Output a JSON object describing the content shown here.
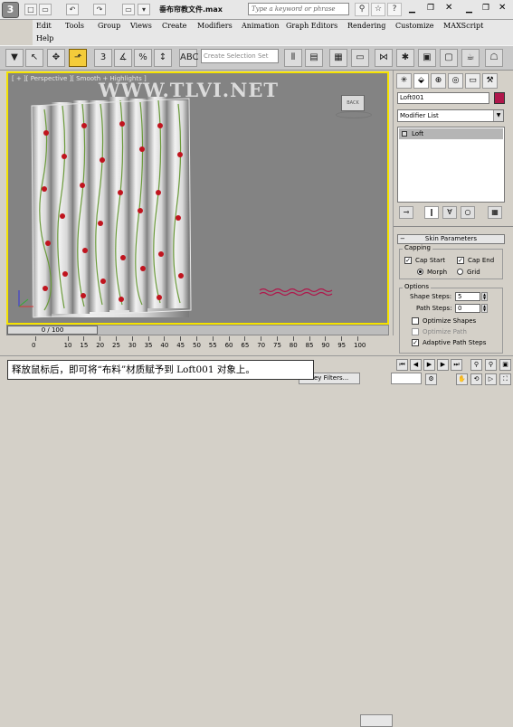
{
  "titlebar": {
    "logo_glyph": "3",
    "doc_title": "垂布帘教文件.max",
    "search_placeholder": "Type a keyword or phrase",
    "quick_access": [
      "□",
      "▭",
      "↶",
      "↷",
      "▭",
      "▾"
    ],
    "tools": [
      "⚲",
      "☆",
      "?"
    ]
  },
  "menu": {
    "row1": [
      "Edit",
      "Tools",
      "Group",
      "Views",
      "Create",
      "Modifiers",
      "Animation",
      "Graph Editors",
      "Rendering",
      "Customize",
      "MAXScript"
    ],
    "row2": [
      "Help"
    ]
  },
  "toolbar": {
    "selection_set_placeholder": "Create Selection Set",
    "buttons": [
      "▼",
      "↖",
      "✥",
      "⬏",
      "3",
      "%",
      "↕",
      "ABC"
    ]
  },
  "viewport": {
    "label": "[ + ][ Perspective ][ Smooth + Highlights ]",
    "watermark": "WWW.TLVI.NET",
    "viewcube_face": "BACK"
  },
  "command_panel": {
    "tabs": [
      "✳",
      "⬙",
      "⊕",
      "◎",
      "▭",
      "⚒"
    ],
    "object_name": "Loft001",
    "object_color": "#b0174b",
    "modifier_list_label": "Modifier List",
    "stack_item": "Loft",
    "stack_buttons": [
      "⊸",
      "‖",
      "∀",
      "○",
      "▦"
    ],
    "rollout_title": "Skin Parameters",
    "capping": {
      "title": "Capping",
      "cap_start_label": "Cap Start",
      "cap_start": true,
      "cap_end_label": "Cap End",
      "cap_end": true,
      "morph_label": "Morph",
      "grid_label": "Grid",
      "selected": "Morph"
    },
    "options": {
      "title": "Options",
      "shape_steps_label": "Shape Steps:",
      "shape_steps": "5",
      "path_steps_label": "Path Steps:",
      "path_steps": "0",
      "optimize_shapes_label": "Optimize Shapes",
      "optimize_shapes": false,
      "optimize_path_label": "Optimize Path",
      "optimize_path": false,
      "adaptive_path_label": "Adaptive Path Steps",
      "adaptive_path": true
    }
  },
  "timeline": {
    "slider_label": "0 / 100",
    "ticks": [
      "0",
      "10",
      "15",
      "20",
      "25",
      "30",
      "35",
      "40",
      "45",
      "50",
      "55",
      "60",
      "65",
      "70",
      "75",
      "80",
      "85",
      "90",
      "95",
      "100"
    ],
    "key_filters_label": "Key Filters..."
  },
  "caption": "释放鼠标后，即可将“布料”材质赋予到 Loft001 对象上。",
  "colors": {
    "viewport_bg": "#838383",
    "active_border": "#f5e300",
    "curtain_flower": "#c0141e",
    "path_line": "#b0174b"
  }
}
